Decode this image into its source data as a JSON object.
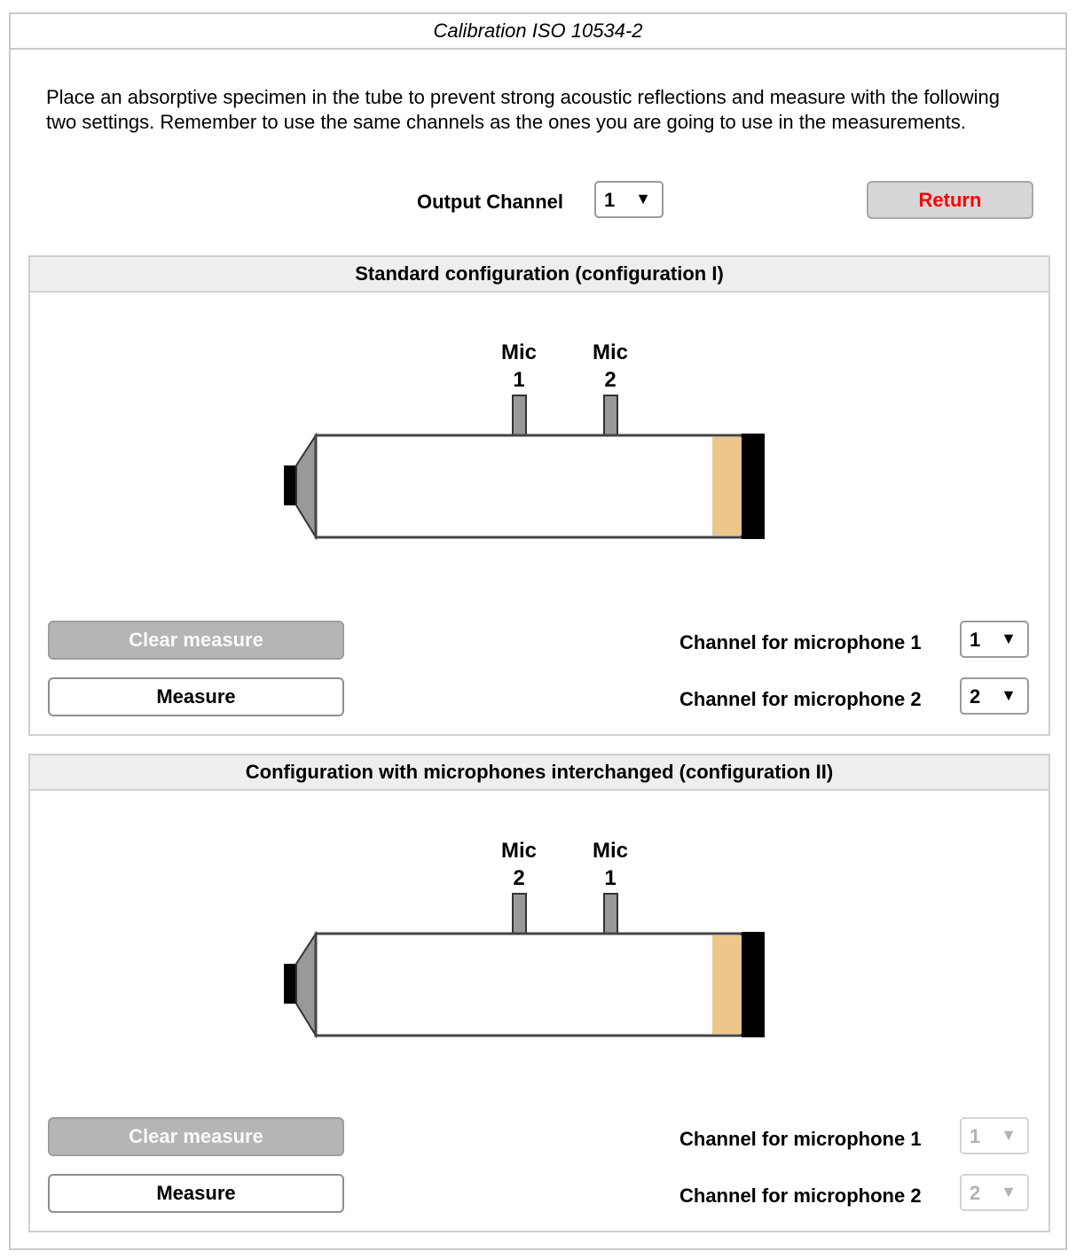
{
  "window": {
    "title": "Calibration ISO 10534-2"
  },
  "instructions": "Place an absorptive specimen in the tube to prevent strong acoustic reflections and measure with the following two settings. Remember to use the same channels as the ones you are going to use in the measurements.",
  "output": {
    "label": "Output Channel",
    "value": "1"
  },
  "return_label": "Return",
  "config1": {
    "title": "Standard configuration (configuration I)",
    "mic_left": {
      "word": "Mic",
      "num": "1"
    },
    "mic_right": {
      "word": "Mic",
      "num": "2"
    },
    "clear_label": "Clear measure",
    "measure_label": "Measure",
    "ch1_label": "Channel for microphone 1",
    "ch1_value": "1",
    "ch2_label": "Channel for microphone 2",
    "ch2_value": "2"
  },
  "config2": {
    "title": "Configuration with microphones interchanged (configuration II)",
    "mic_left": {
      "word": "Mic",
      "num": "2"
    },
    "mic_right": {
      "word": "Mic",
      "num": "1"
    },
    "clear_label": "Clear measure",
    "measure_label": "Measure",
    "ch1_label": "Channel for microphone 1",
    "ch1_value": "1",
    "ch2_label": "Channel for microphone 2",
    "ch2_value": "2"
  },
  "icons": {
    "dropdown": "triangle-down-icon"
  },
  "colors": {
    "return_text": "#ff0000",
    "specimen": "#ecc68a",
    "mic": "#999999",
    "disabled": "#b3b3b3"
  }
}
